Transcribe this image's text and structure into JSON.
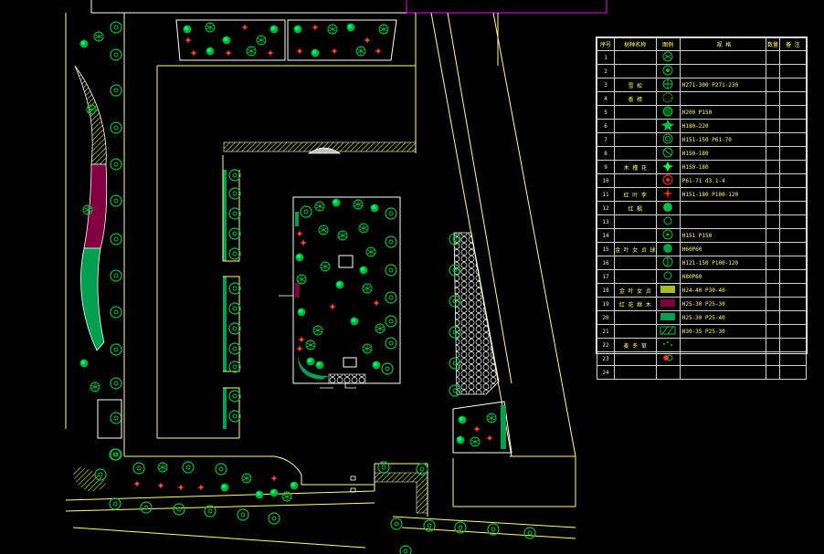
{
  "legend": {
    "headers": [
      "序号",
      "树种名称",
      "图例",
      "规 格",
      "数量",
      "备 注"
    ],
    "rows": [
      {
        "no": "1",
        "name": "",
        "spec": "",
        "sym": "tree-a"
      },
      {
        "no": "2",
        "name": "",
        "spec": "",
        "sym": "tree-b"
      },
      {
        "no": "3",
        "name": "雪 松",
        "spec": "H271-300 P271-230",
        "sym": "conifer"
      },
      {
        "no": "4",
        "name": "香 樟",
        "spec": "",
        "sym": "tree-c"
      },
      {
        "no": "5",
        "name": "",
        "spec": "H200 P150",
        "sym": "tree-d"
      },
      {
        "no": "6",
        "name": "",
        "spec": "H180-220",
        "sym": "star-green"
      },
      {
        "no": "7",
        "name": "",
        "spec": "H151-150 P61-70",
        "sym": "tree-e"
      },
      {
        "no": "8",
        "name": "",
        "spec": "H150-180",
        "sym": "tree-f"
      },
      {
        "no": "9",
        "name": "木 槿 花",
        "spec": "H150-180",
        "sym": "shrub-green"
      },
      {
        "no": "10",
        "name": "",
        "spec": "P61-71 d3.1-4",
        "sym": "red-flower"
      },
      {
        "no": "11",
        "name": "红 叶 李",
        "spec": "H151-180 P100-120",
        "sym": "red-star"
      },
      {
        "no": "12",
        "name": "红 枫",
        "spec": "",
        "sym": "tree-g"
      },
      {
        "no": "13",
        "name": "",
        "spec": "",
        "sym": "tree-h"
      },
      {
        "no": "14",
        "name": "",
        "spec": "H151 P150",
        "sym": "tree-i"
      },
      {
        "no": "15",
        "name": "金 叶 女 贞 球",
        "spec": "H60P60",
        "sym": "ball"
      },
      {
        "no": "16",
        "name": "",
        "spec": "H121-150 P100-120",
        "sym": "tree-j"
      },
      {
        "no": "17",
        "name": "",
        "spec": "H80P60",
        "sym": "tree-k"
      },
      {
        "no": "18",
        "name": "金 叶 女 贞",
        "spec": "H24-40 P30-40",
        "sym": "hatch-yg"
      },
      {
        "no": "19",
        "name": "红 花 继 木",
        "spec": "H25-30 P25-30",
        "sym": "fill-maroon"
      },
      {
        "no": "20",
        "name": "",
        "spec": "H25-30 P25-40",
        "sym": "fill-green"
      },
      {
        "no": "21",
        "name": "",
        "spec": "H30-35 P25-30",
        "sym": "hatch-green"
      },
      {
        "no": "22",
        "name": "麦 冬 草",
        "spec": "",
        "sym": "grass-dots"
      },
      {
        "no": "23",
        "name": "",
        "spec": "",
        "sym": "red-cluster"
      },
      {
        "no": "24",
        "name": "",
        "spec": "",
        "sym": "none"
      }
    ]
  },
  "colors": {
    "background": "#000000",
    "road_line": "#ffff80",
    "boundary": "#ffffff",
    "magenta": "#ff00ff",
    "tree_green": "#00c040",
    "bright_green": "#00ff40",
    "red_flower": "#ff3010",
    "maroon_bed": "#800040",
    "hedge_green": "#00a050",
    "hatch_yellow_green": "#a0c020"
  }
}
